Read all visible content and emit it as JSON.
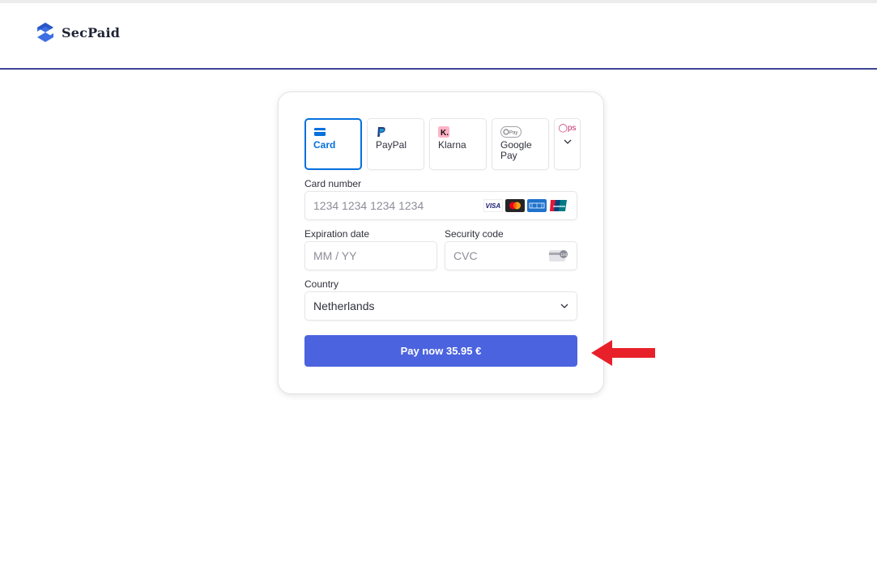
{
  "brand": {
    "name": "SecPaid",
    "logo_icon": "secpaid-s-logo"
  },
  "payment_methods": [
    {
      "label": "Card",
      "icon": "credit-card-icon",
      "active": true
    },
    {
      "label": "PayPal",
      "icon": "paypal-icon",
      "active": false
    },
    {
      "label": "Klarna",
      "icon": "klarna-icon",
      "active": false
    },
    {
      "label": "Google Pay",
      "icon": "google-pay-icon",
      "active": false
    }
  ],
  "more_methods": {
    "partial_label": "ps",
    "icon": "chevron-down-icon"
  },
  "card_number": {
    "label": "Card number",
    "placeholder": "1234 1234 1234 1234",
    "brand_icons": [
      "visa-icon",
      "mastercard-icon",
      "amex-icon",
      "unionpay-icon"
    ]
  },
  "expiry": {
    "label": "Expiration date",
    "placeholder": "MM / YY"
  },
  "cvc": {
    "label": "Security code",
    "placeholder": "CVC",
    "icon": "cvc-card-icon"
  },
  "country": {
    "label": "Country",
    "value": "Netherlands"
  },
  "pay_button": {
    "label": "Pay now 35.95 €"
  },
  "annotation": {
    "icon": "red-arrow-left-icon",
    "color": "#e8202a"
  },
  "colors": {
    "accent": "#0570de",
    "pay_button": "#4b63de",
    "header_rule": "#3f4494"
  }
}
